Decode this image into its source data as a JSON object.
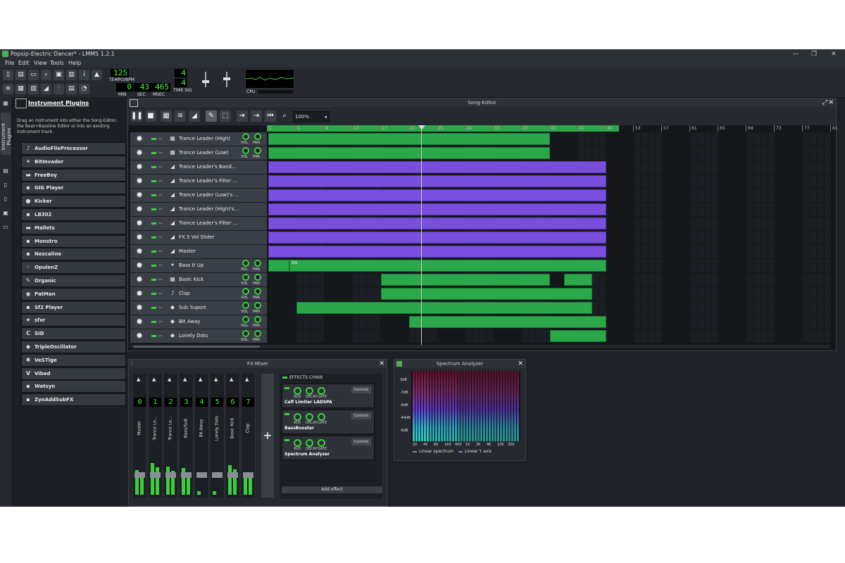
{
  "window": {
    "title": "Popsip-Electric Dancer* - LMMS 1.2.1",
    "minimize": "—",
    "restore": "❐",
    "close": "✕"
  },
  "menu": [
    "File",
    "Edit",
    "View",
    "Tools",
    "Help"
  ],
  "transport": {
    "tempo_value": "125",
    "tempo_label": "TEMPO/BPM",
    "min": "0",
    "sec": "43",
    "msec": "465",
    "min_label": "MIN",
    "sec_label": "SEC",
    "msec_label": "MSEC",
    "timesig_num": "4",
    "timesig_den": "4",
    "timesig_label": "TIME SIG",
    "cpu_label": "CPU"
  },
  "sidebar": {
    "tab_label": "Instrument Plugins"
  },
  "plugins": {
    "title": "Instrument Plugins",
    "description": "Drag an instrument into either the Song-Editor, the Beat+Bassline Editor or into an existing instrument track.",
    "items": [
      {
        "label": "AudioFileProcessor",
        "icon": "♪"
      },
      {
        "label": "BitInvader",
        "icon": "✶"
      },
      {
        "label": "FreeBoy",
        "icon": "▬"
      },
      {
        "label": "GIG Player",
        "icon": "▪"
      },
      {
        "label": "Kicker",
        "icon": "●"
      },
      {
        "label": "LB302",
        "icon": "▪"
      },
      {
        "label": "Mallets",
        "icon": "▬"
      },
      {
        "label": "Monstro",
        "icon": "▪"
      },
      {
        "label": "Nescaline",
        "icon": "▪"
      },
      {
        "label": "OpulenZ",
        "icon": "◦"
      },
      {
        "label": "Organic",
        "icon": "✎"
      },
      {
        "label": "PatMan",
        "icon": "◉"
      },
      {
        "label": "Sf2 Player",
        "icon": "▪"
      },
      {
        "label": "sfxr",
        "icon": "★"
      },
      {
        "label": "SID",
        "icon": "C"
      },
      {
        "label": "TripleOscillator",
        "icon": "◆"
      },
      {
        "label": "VeSTige",
        "icon": "✱"
      },
      {
        "label": "Vibed",
        "icon": "V"
      },
      {
        "label": "Watsyn",
        "icon": "▪"
      },
      {
        "label": "ZynAddSubFX",
        "icon": "▪"
      }
    ]
  },
  "song_editor": {
    "title": "Song-Editor",
    "zoom": "100%",
    "bars": [
      "1",
      "5",
      "9",
      "13",
      "17",
      "21",
      "25",
      "29",
      "33",
      "37",
      "41",
      "45",
      "49",
      "53",
      "57",
      "61",
      "65",
      "69",
      "73",
      "77",
      "81"
    ],
    "vol_label": "VOL",
    "pan_label": "PAN",
    "tracks": [
      {
        "name": "Trance Leader (High)",
        "kind": "instrument",
        "icon": "▦",
        "clips": [
          {
            "start": 1,
            "end": 41,
            "color": "green",
            "label": ""
          }
        ]
      },
      {
        "name": "Trance Leader (Low)",
        "kind": "instrument",
        "icon": "▦",
        "clips": [
          {
            "start": 1,
            "end": 41,
            "color": "green",
            "label": ""
          }
        ]
      },
      {
        "name": "Trance Leader's Band...",
        "kind": "automation",
        "icon": "◢",
        "clips": [
          {
            "start": 1,
            "end": 49,
            "color": "purple",
            "label": ""
          }
        ]
      },
      {
        "name": "Trance Leader's Filter ...",
        "kind": "automation",
        "icon": "◢",
        "clips": [
          {
            "start": 1,
            "end": 49,
            "color": "purple",
            "label": ""
          }
        ]
      },
      {
        "name": "Trance Leader (Low)'s ...",
        "kind": "automation",
        "icon": "◢",
        "clips": [
          {
            "start": 1,
            "end": 49,
            "color": "purple",
            "label": ""
          }
        ]
      },
      {
        "name": "Trance Leader (High)'s...",
        "kind": "automation",
        "icon": "◢",
        "clips": [
          {
            "start": 1,
            "end": 49,
            "color": "purple",
            "label": ""
          }
        ]
      },
      {
        "name": "Trance Leader's Filter ...",
        "kind": "automation",
        "icon": "◢",
        "clips": [
          {
            "start": 1,
            "end": 49,
            "color": "purple",
            "label": ""
          }
        ]
      },
      {
        "name": "FX 5 Vol Slider",
        "kind": "automation",
        "icon": "◢",
        "clips": [
          {
            "start": 1,
            "end": 49,
            "color": "purple",
            "label": ""
          }
        ]
      },
      {
        "name": "Master",
        "kind": "automation",
        "icon": "◢",
        "clips": [
          {
            "start": 1,
            "end": 49,
            "color": "purple",
            "label": ""
          }
        ]
      },
      {
        "name": "Bass It Up",
        "kind": "instrument",
        "icon": "✶",
        "clips": [
          {
            "start": 1,
            "end": 4,
            "color": "green",
            "label": ""
          },
          {
            "start": 4,
            "end": 49,
            "color": "green",
            "label": "Do"
          }
        ]
      },
      {
        "name": "Basic Kick",
        "kind": "instrument",
        "icon": "▦",
        "clips": [
          {
            "start": 17,
            "end": 41,
            "color": "green",
            "label": ""
          },
          {
            "start": 43,
            "end": 47,
            "color": "green",
            "label": ""
          }
        ]
      },
      {
        "name": "Clap",
        "kind": "instrument",
        "icon": "♪",
        "clips": [
          {
            "start": 17,
            "end": 47,
            "color": "green",
            "label": ""
          }
        ]
      },
      {
        "name": "Sub Suport",
        "kind": "instrument",
        "icon": "◆",
        "clips": [
          {
            "start": 5,
            "end": 47,
            "color": "green",
            "label": ""
          }
        ]
      },
      {
        "name": "Bit Away",
        "kind": "instrument",
        "icon": "◆",
        "clips": [
          {
            "start": 21,
            "end": 49,
            "color": "green",
            "label": ""
          }
        ]
      },
      {
        "name": "Lonely Dots",
        "kind": "instrument",
        "icon": "◆",
        "clips": [
          {
            "start": 41,
            "end": 49,
            "color": "green",
            "label": ""
          }
        ]
      }
    ]
  },
  "fx_mixer": {
    "title": "FX-Mixer",
    "channels": [
      {
        "num": "0",
        "name": "Master",
        "level": 0.35
      },
      {
        "num": "1",
        "name": "Trance Le...",
        "level": 0.45
      },
      {
        "num": "2",
        "name": "Trance Le...",
        "level": 0.4
      },
      {
        "num": "3",
        "name": "Bass/Sub",
        "level": 0.38
      },
      {
        "num": "4",
        "name": "Bit Away",
        "level": 0.05
      },
      {
        "num": "5",
        "name": "Lonely Dots",
        "level": 0.05
      },
      {
        "num": "6",
        "name": "Basic Kick",
        "level": 0.42
      },
      {
        "num": "7",
        "name": "Clap",
        "level": 0.3
      }
    ],
    "add_channel": "+",
    "effects_chain_label": "EFFECTS CHAIN",
    "effects": [
      {
        "name": "Calf Limiter LADSPA",
        "controls": "Controls",
        "knobs": [
          "W/D",
          "DECAY",
          "GATE"
        ]
      },
      {
        "name": "BassBooster",
        "controls": "Controls",
        "knobs": [
          "W/D",
          "DECAY",
          "GATE"
        ]
      },
      {
        "name": "Spectrum Analyzer",
        "controls": "Controls",
        "knobs": [
          "W/D",
          "DECAY",
          "GATE"
        ]
      }
    ],
    "add_effect": "Add effect"
  },
  "spectrum": {
    "title": "Spectrum Analyzer",
    "db_labels": [
      "3dB",
      "-3dB",
      "-6dB",
      "-44dB",
      "-6dB"
    ],
    "freq_labels": [
      "20",
      "40",
      "80",
      "160",
      "400",
      "1K",
      "2K",
      "4K",
      "10K",
      "20K"
    ],
    "legend": [
      "Linear spectrum",
      "Linear Y axis"
    ]
  }
}
